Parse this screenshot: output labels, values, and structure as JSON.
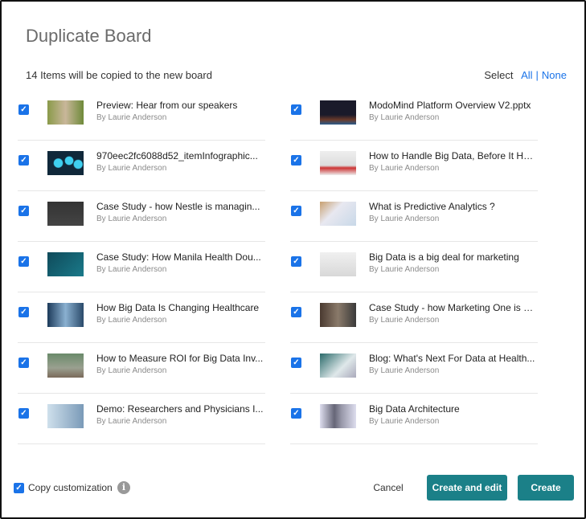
{
  "title": "Duplicate Board",
  "count_text": "14 Items will be copied to the new board",
  "select": {
    "label": "Select",
    "all": "All",
    "sep": "|",
    "none": "None"
  },
  "by": "By Laurie Anderson",
  "left": [
    {
      "title": "Preview: Hear from our speakers",
      "thumb": "linear-gradient(90deg,#8a9a4a,#c9b79a 50%,#6f8a3a)"
    },
    {
      "title": "970eec2fc6088d52_itemInfographic...",
      "thumb": "radial-gradient(circle at 30% 50%,#3fd0f0 15%,transparent 18%),radial-gradient(circle at 60% 40%,#3fd0f0 15%,transparent 18%),radial-gradient(circle at 85% 55%,#3fd0f0 12%,transparent 15%),#10283a"
    },
    {
      "title": "Case Study - how Nestle is managin...",
      "thumb": "linear-gradient(#333,#444)"
    },
    {
      "title": "Case Study: How Manila Health Dou...",
      "thumb": "linear-gradient(135deg,#0f4a5a,#1a7a8a)"
    },
    {
      "title": "How Big Data Is Changing Healthcare",
      "thumb": "linear-gradient(90deg,#1c3a5a,#8ab0d0 50%,#2a4a6a)"
    },
    {
      "title": "How to Measure ROI for Big Data Inv...",
      "thumb": "linear-gradient(#6a8a6a,#9aa090 60%,#7a6a5a)"
    },
    {
      "title": "Demo: Researchers and Physicians I...",
      "thumb": "linear-gradient(90deg,#cfe0ec,#7a9ab8)"
    }
  ],
  "right": [
    {
      "title": "ModoMind Platform Overview V2.pptx",
      "thumb": "linear-gradient(#1a1a2a 60%,#6a3a2a 80%,#2a5a8a)"
    },
    {
      "title": "How to Handle Big Data, Before It Ha...",
      "thumb": "linear-gradient(#eee,#ddd 60%,#c33 70%,#eee)"
    },
    {
      "title": "What is Predictive Analytics ?",
      "thumb": "linear-gradient(135deg,#c8a070,#e8e8f0 40%,#c8d8e8)"
    },
    {
      "title": "Big Data is a big deal for marketing",
      "thumb": "linear-gradient(#f0f0f0,#d8d8d8)"
    },
    {
      "title": "Case Study - how Marketing One is w...",
      "thumb": "linear-gradient(90deg,#4a3a30,#8a7a6a,#3a3a3a)"
    },
    {
      "title": "Blog: What's Next For Data at Health...",
      "thumb": "linear-gradient(135deg,#2a6a6a,#dfe8ea 60%,#aab)"
    },
    {
      "title": "Big Data Architecture",
      "thumb": "linear-gradient(90deg,#dde,#667 40%,#99a 60%,#dde)"
    }
  ],
  "footer": {
    "copy_label": "Copy customization",
    "info": "i",
    "cancel": "Cancel",
    "create_edit": "Create and edit",
    "create": "Create"
  },
  "check": "✓"
}
